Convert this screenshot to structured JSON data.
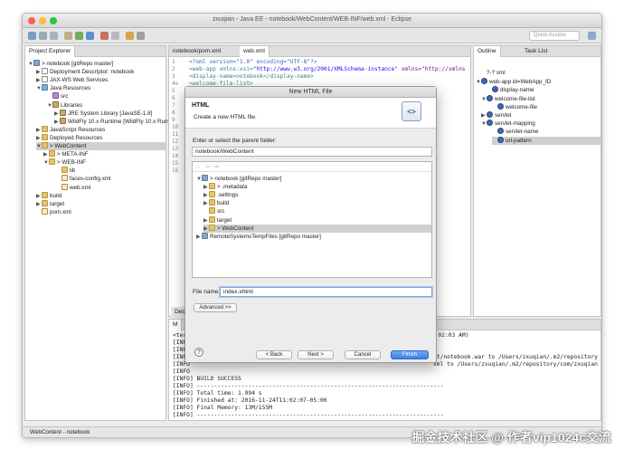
{
  "window": {
    "title": "zxuqian - Java EE - notebook/WebContent/WEB-INF/web.xml - Eclipse"
  },
  "toolbar": {
    "quick_access": "Quick Access"
  },
  "explorer": {
    "tab": "Project Explorer",
    "rows": [
      {
        "text": "> notebook [gitRepo master]",
        "icon": "proj",
        "arrow": "▼"
      },
      {
        "text": "Deployment Descriptor: notebook",
        "icon": "file",
        "arrow": "▶"
      },
      {
        "text": "JAX-WS Web Services",
        "icon": "file",
        "arrow": "▶"
      },
      {
        "text": "Java Resources",
        "icon": "java",
        "arrow": "▼"
      },
      {
        "text": "src",
        "icon": "pkg",
        "arrow": ""
      },
      {
        "text": "Libraries",
        "icon": "lib",
        "arrow": "▼"
      },
      {
        "text": "JRE System Library [JavaSE-1.8]",
        "icon": "lib",
        "arrow": "▶"
      },
      {
        "text": "WildFly 10.x Runtime [WildFly 10.x Runt",
        "icon": "lib",
        "arrow": "▶"
      },
      {
        "text": "JavaScript Resources",
        "icon": "folder",
        "arrow": "▶"
      },
      {
        "text": "Deployed Resources",
        "icon": "folder",
        "arrow": "▶"
      },
      {
        "text": "> WebContent",
        "icon": "folder",
        "arrow": "▼"
      },
      {
        "text": "> META-INF",
        "icon": "folder",
        "arrow": "▶"
      },
      {
        "text": "> WEB-INF",
        "icon": "folder",
        "arrow": "▼"
      },
      {
        "text": "lib",
        "icon": "folder",
        "arrow": ""
      },
      {
        "text": "faces-config.xml",
        "icon": "xml",
        "arrow": ""
      },
      {
        "text": "web.xml",
        "icon": "xml",
        "arrow": ""
      },
      {
        "text": "build",
        "icon": "folder",
        "arrow": "▶"
      },
      {
        "text": "target",
        "icon": "folder",
        "arrow": "▶"
      },
      {
        "text": "pom.xml",
        "icon": "xml",
        "arrow": ""
      }
    ]
  },
  "editor": {
    "tabs": [
      "notebook/pom.xml",
      "web.xml"
    ],
    "line_numbers": [
      "1",
      "2",
      "3",
      "4⊖",
      "5",
      "6",
      "7",
      "8",
      "9",
      "10",
      "11",
      "12",
      "13",
      "14",
      "15",
      "16"
    ],
    "line1": "<?xml version=\"1.0\" encoding=\"UTF-8\"?>",
    "line2a": "<web-app xmlns:xsi=",
    "line2b": "\"http://www.w3.org/2001/XMLSchema-instance\"",
    "line2c": " xmlns=\"http://xmlns",
    "line3": "  <display-name>notebook</display-name>",
    "line4": "  <welcome-file-list>",
    "design_tab": "Desig"
  },
  "outline": {
    "tabs": [
      "Outline",
      "Task List"
    ],
    "rows": [
      {
        "text": "?-? xml",
        "icon": "",
        "arrow": ""
      },
      {
        "text": "web-app id=WebApp_ID",
        "icon": "elem",
        "arrow": "▼"
      },
      {
        "text": "display-name",
        "icon": "elem",
        "arrow": ""
      },
      {
        "text": "welcome-file-list",
        "icon": "elem",
        "arrow": "▼"
      },
      {
        "text": "welcome-file",
        "icon": "elem",
        "arrow": ""
      },
      {
        "text": "servlet",
        "icon": "elem",
        "arrow": "▶"
      },
      {
        "text": "servlet-mapping",
        "icon": "elem",
        "arrow": "▼"
      },
      {
        "text": "servlet-name",
        "icon": "elem",
        "arrow": ""
      },
      {
        "text": "url-pattern",
        "icon": "elem",
        "arrow": ""
      }
    ]
  },
  "console": {
    "tab_prefix": "M",
    "term": "<term",
    "timestamp": "11:02:03 AM)",
    "lines": [
      "[INFO",
      "[INFO",
      "[INFO",
      "[INFO",
      "[INFO",
      "[INFO] BUILD SUCCESS",
      "[INFO] ------------------------------------------------------------------------",
      "[INFO] Total time: 1.994 s",
      "[INFO] Finished at: 2016-11-24T11:02:07-05:00",
      "[INFO] Final Memory: 13M/155M",
      "[INFO] ------------------------------------------------------------------------"
    ],
    "right1": "et/notebook.war to /Users/zxuqian/.m2/repository",
    "right2": "xml to /Users/zxuqian/.m2/repository/com/zxuqian"
  },
  "status_bar": "WebContent - notebook",
  "dialog": {
    "title": "New HTML File",
    "heading": "HTML",
    "description": "Create a new HTML file.",
    "parent_label": "Enter or select the parent folder:",
    "parent_value": "notebook/WebContent",
    "tree": [
      {
        "text": "> notebook [gitRepo master]",
        "arrow": "▼",
        "icon": "proj"
      },
      {
        "text": "> .metadata",
        "arrow": "▶",
        "icon": "folder"
      },
      {
        "text": ".settings",
        "arrow": "▶",
        "icon": "folder"
      },
      {
        "text": "build",
        "arrow": "▶",
        "icon": "folder"
      },
      {
        "text": "src",
        "arrow": "",
        "icon": "folder"
      },
      {
        "text": "target",
        "arrow": "▶",
        "icon": "folder"
      },
      {
        "text": "> WebContent",
        "arrow": "▶",
        "icon": "folder"
      },
      {
        "text": "RemoteSystemsTempFiles [gitRepo master]",
        "arrow": "▶",
        "icon": "proj"
      }
    ],
    "filename_label": "File name:",
    "filename_value": "index.xhtml",
    "advanced": "Advanced >>",
    "back": "< Back",
    "next": "Next >",
    "cancel": "Cancel",
    "finish": "Finish",
    "help": "?"
  },
  "watermark": "掘金技术社区 @ 作者vip1024c交流"
}
